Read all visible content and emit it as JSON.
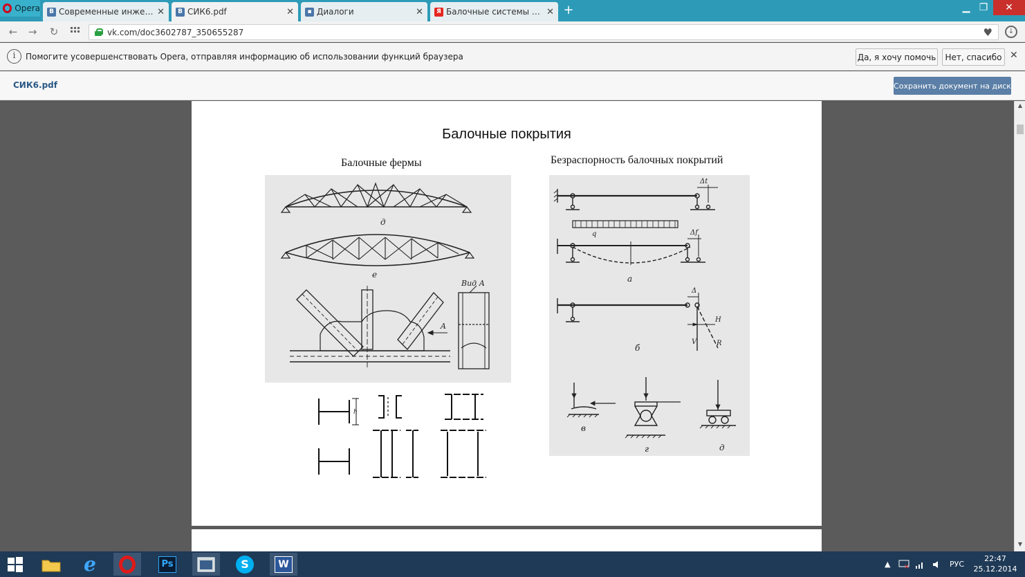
{
  "browser": {
    "menu_label": "Opera",
    "tabs": [
      {
        "title": "Современные инженерные",
        "favicon": "В",
        "favicon_color": "#4a76a8"
      },
      {
        "title": "СИК6.pdf",
        "favicon": "В",
        "favicon_color": "#4a76a8"
      },
      {
        "title": "Диалоги",
        "favicon": "▪",
        "favicon_color": "#4a76a8"
      },
      {
        "title": "Балочные системы большие",
        "favicon": "Я",
        "favicon_color": "#e52620"
      }
    ],
    "new_tab": "+",
    "url": "vk.com/doc3602787_350655287"
  },
  "infobar": {
    "message": "Помогите усовершенствовать Opera, отправляя информацию об использовании функций браузера",
    "accept_label": "Да, я хочу помочь",
    "decline_label": "Нет, спасибо"
  },
  "doc": {
    "name": "СИК6.pdf",
    "save_label": "Сохранить документ на диск"
  },
  "page": {
    "title": "Балочные покрытия",
    "left_caption": "Балочные фермы",
    "right_caption": "Безраспорность балочных покрытий",
    "fig_labels_left": {
      "d": "д",
      "e": "е",
      "view": "Вид А",
      "arrow": "A",
      "h": "h"
    },
    "fig_labels_right": {
      "dt": "Δt",
      "q": "q",
      "df": "Δf",
      "a": "а",
      "delta": "Δ",
      "b": "б",
      "H": "H",
      "V": "V",
      "R": "R",
      "v": "в",
      "g": "г",
      "d": "д"
    }
  },
  "taskbar": {
    "lang": "РУС",
    "time": "22:47",
    "date": "25.12.2014",
    "ps_label": "Ps",
    "word_label": "W"
  }
}
